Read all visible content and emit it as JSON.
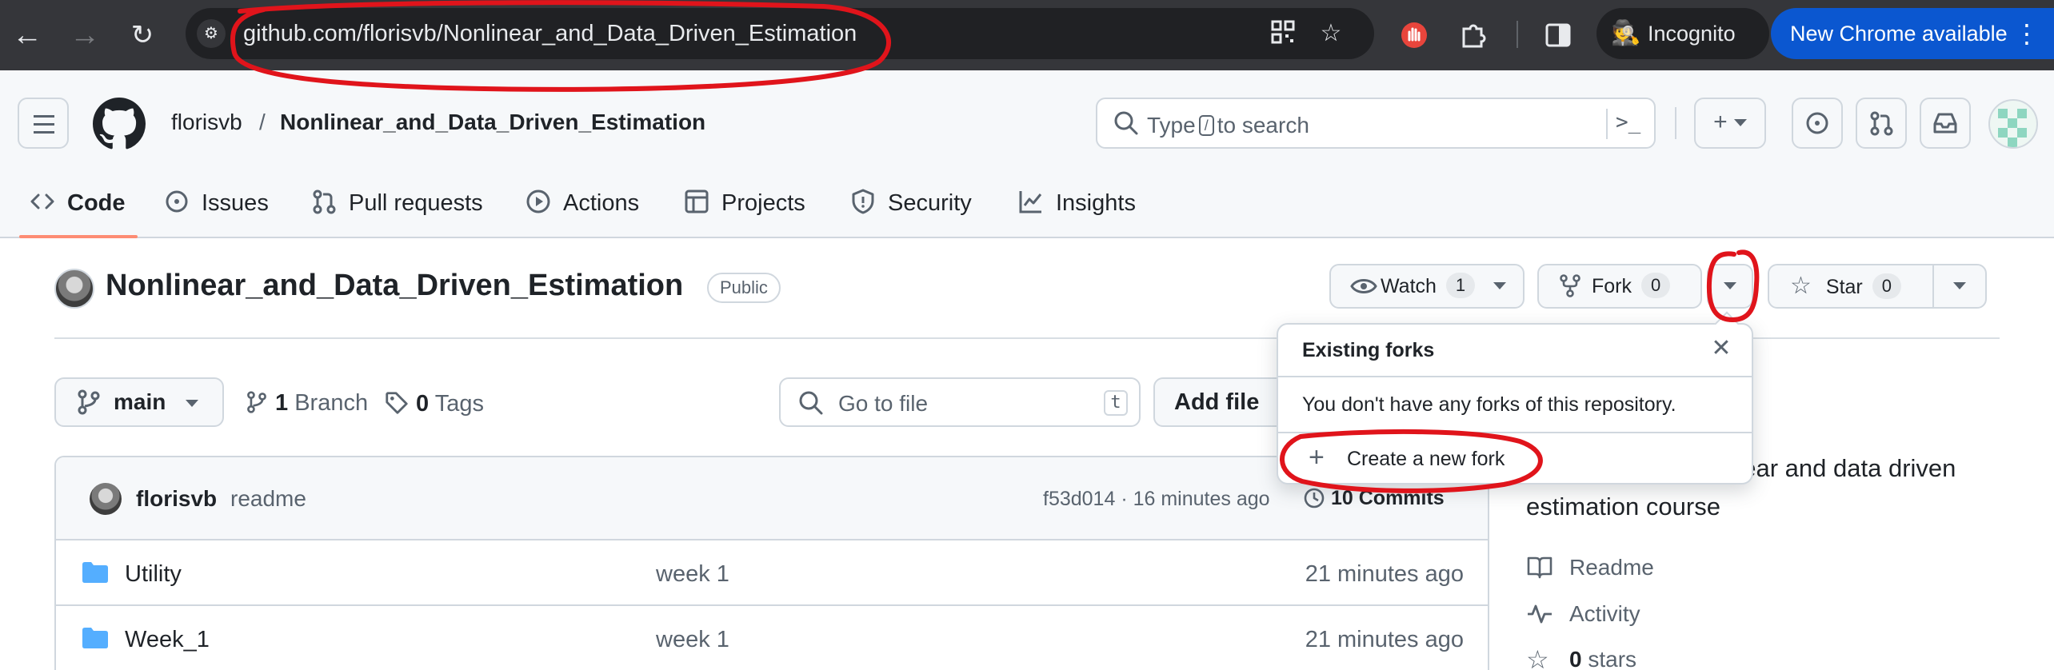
{
  "browser": {
    "url": "github.com/florisvb/Nonlinear_and_Data_Driven_Estimation",
    "incognito_label": "Incognito",
    "update_label": "New Chrome available",
    "icons": [
      "back-icon",
      "forward-icon",
      "reload-icon",
      "site-info-icon",
      "qr-code-icon",
      "bookmark-star-icon",
      "extension-stop-icon",
      "extensions-puzzle-icon",
      "side-panel-icon",
      "incognito-icon",
      "more-vert-icon"
    ]
  },
  "header": {
    "owner": "florisvb",
    "separator": "/",
    "repo": "Nonlinear_and_Data_Driven_Estimation",
    "search_prefix": "Type",
    "search_key": "/",
    "search_suffix": "to search",
    "terminal_glyph": ">_"
  },
  "tabs": [
    {
      "label": "Code",
      "icon": "code-icon"
    },
    {
      "label": "Issues",
      "icon": "issue-icon"
    },
    {
      "label": "Pull requests",
      "icon": "pull-request-icon"
    },
    {
      "label": "Actions",
      "icon": "actions-play-icon"
    },
    {
      "label": "Projects",
      "icon": "projects-table-icon"
    },
    {
      "label": "Security",
      "icon": "shield-icon"
    },
    {
      "label": "Insights",
      "icon": "graph-icon"
    }
  ],
  "repo": {
    "title": "Nonlinear_and_Data_Driven_Estimation",
    "visibility": "Public",
    "watch_label": "Watch",
    "watch_count": "1",
    "fork_label": "Fork",
    "fork_count": "0",
    "star_label": "Star",
    "star_count": "0"
  },
  "branch": {
    "name": "main",
    "branches_count": "1",
    "branches_label": "Branch",
    "tags_count": "0",
    "tags_label": "Tags",
    "goto_placeholder": "Go to file",
    "goto_key": "t",
    "add_file_label": "Add file"
  },
  "commit": {
    "author": "florisvb",
    "message": "readme",
    "hash_time": "f53d014 · 16 minutes ago",
    "commits_label": "10 Commits"
  },
  "files": [
    {
      "name": "Utility",
      "message": "week 1",
      "time": "21 minutes ago"
    },
    {
      "name": "Week_1",
      "message": "week 1",
      "time": "21 minutes ago"
    }
  ],
  "about": {
    "description_fragment": "nlinear and data driven",
    "description_line2": "estimation course",
    "readme_label": "Readme",
    "activity_label": "Activity",
    "stars_count": "0",
    "stars_label": "stars"
  },
  "fork_menu": {
    "title": "Existing forks",
    "close_glyph": "✕",
    "empty_text": "You don't have any forks of this repository.",
    "create_label": "Create a new fork"
  },
  "colors": {
    "chrome_bar": "#35363a",
    "update_button": "#0b57d0",
    "annotation_red": "#e0141b",
    "tab_underline": "#fd8c73",
    "folder": "#54aeff"
  }
}
